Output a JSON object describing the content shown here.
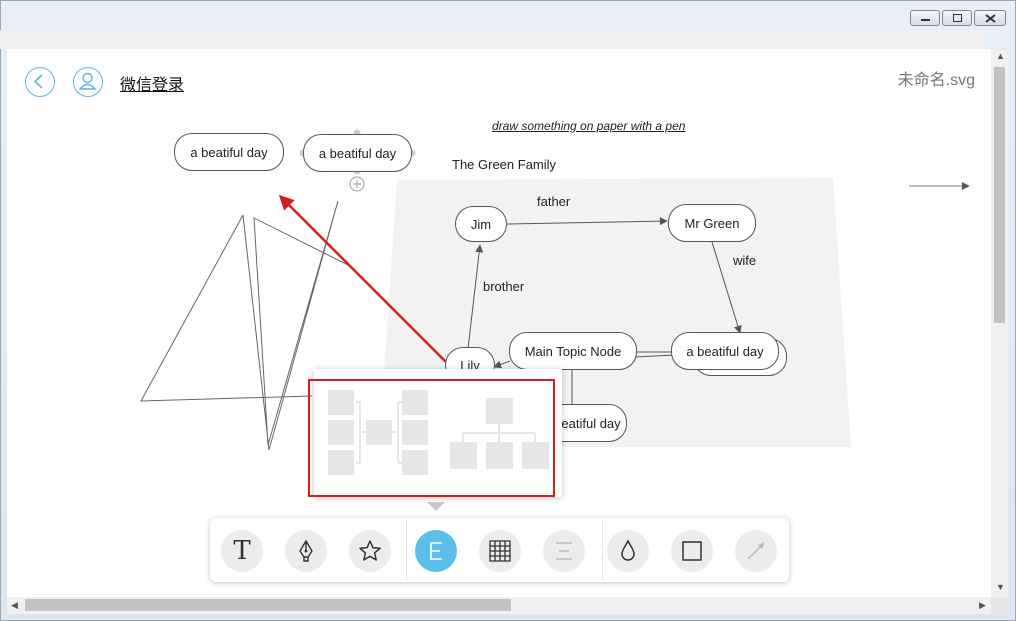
{
  "header": {
    "login_label": "微信登录",
    "filename": "未命名.svg"
  },
  "canvas": {
    "hint_text": "draw something on paper with a pen",
    "family_title": "The Green Family",
    "nodes": {
      "top_left": "a beatiful day",
      "top_selected": "a beatiful day",
      "jim": "Jim",
      "mr_green": "Mr Green",
      "main_topic": "Main Topic Node",
      "beautiful_right": "a beatiful day",
      "lily": "Lily",
      "bottom": "a beatiful day"
    },
    "edge_labels": {
      "father": "father",
      "wife": "wife",
      "brother": "brother"
    }
  },
  "toolbar": {
    "tools": [
      "text-tool",
      "pen-tool",
      "shape-tool",
      "layout-tool",
      "table-tool",
      "align-tool",
      "color-tool",
      "border-tool",
      "connector-tool"
    ],
    "active_tool": "layout-tool"
  },
  "colors": {
    "accent": "#5cbde6",
    "highlight": "#d11f1f"
  }
}
